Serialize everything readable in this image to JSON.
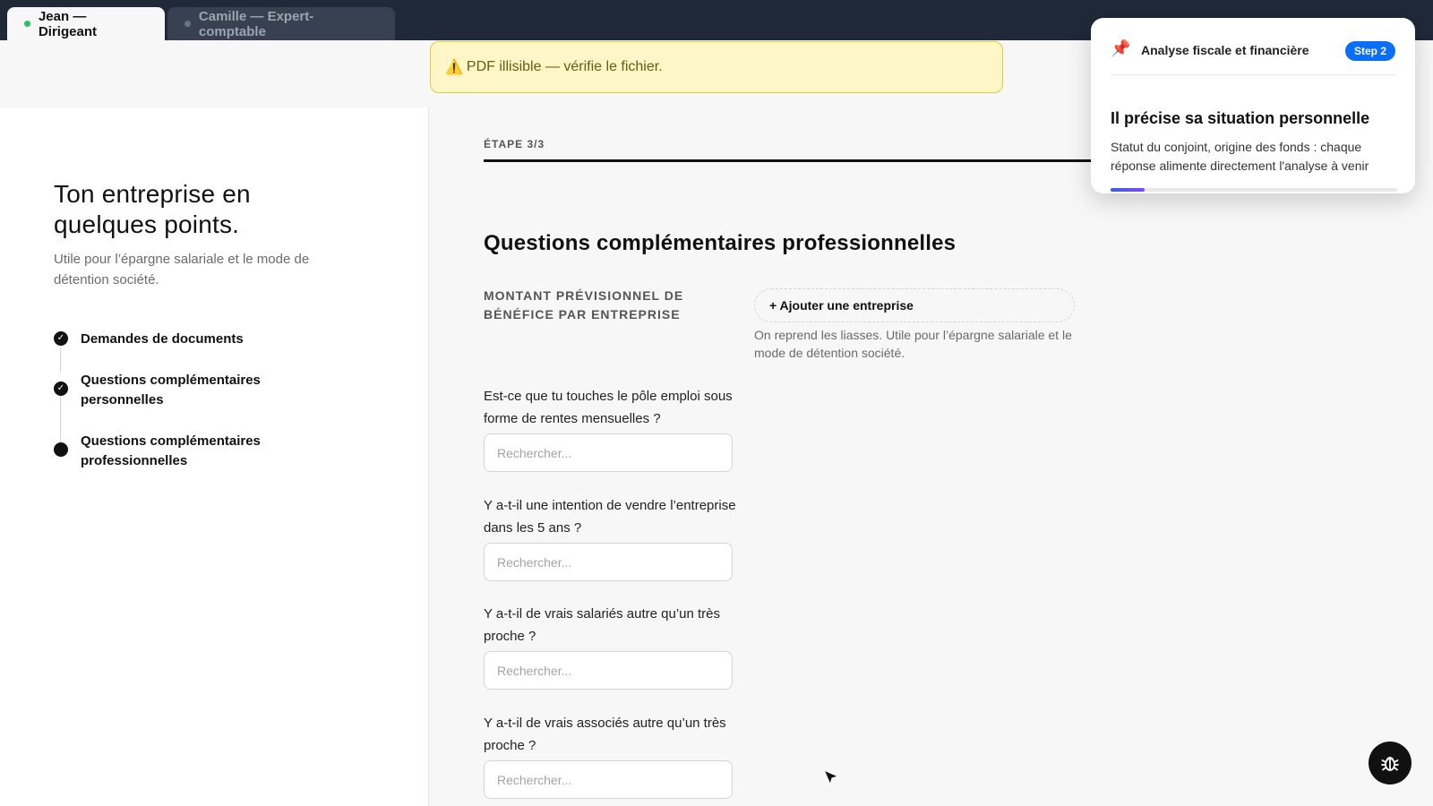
{
  "tabs": [
    {
      "label": "Jean — Dirigeant",
      "status_color": "#22c55e"
    },
    {
      "label": "Camille — Expert-comptable",
      "status_color": "#6b7280"
    }
  ],
  "alert": {
    "icon": "warning-icon",
    "text": "PDF illisible — vérifie le fichier."
  },
  "sidebar": {
    "title": "Ton entreprise en quelques points.",
    "subtitle": "Utile pour l’épargne salariale et le mode de détention société.",
    "steps": [
      {
        "label": "Demandes de documents",
        "state": "done"
      },
      {
        "label": "Questions complémentaires personnelles",
        "state": "done"
      },
      {
        "label": "Questions complémentaires professionnelles",
        "state": "current"
      }
    ]
  },
  "main": {
    "step_indicator": "ÉTAPE 3/3",
    "section_title": "Questions complémentaires professionnelles",
    "montant": {
      "label": "MONTANT PRÉVISIONNEL DE BÉNÉFICE PAR ENTREPRISE",
      "add_button": "+ Ajouter une entreprise",
      "hint": "On reprend les liasses. Utile pour l’épargne salariale et le mode de détention société."
    },
    "questions": [
      {
        "text": "Est-ce que tu touches le pôle emploi sous forme de rentes mensuelles ?",
        "placeholder": "Rechercher...",
        "value": ""
      },
      {
        "text": "Y a-t-il une intention de vendre l’entreprise dans les 5 ans ?",
        "placeholder": "Rechercher...",
        "value": ""
      },
      {
        "text": "Y a-t-il de vrais salariés autre qu’un très proche ?",
        "placeholder": "Rechercher...",
        "value": ""
      },
      {
        "text": "Y a-t-il de vrais associés autre qu’un très proche ?",
        "placeholder": "Rechercher...",
        "value": ""
      }
    ]
  },
  "popover": {
    "icon": "pushpin-icon",
    "kicker": "Analyse fiscale et financière",
    "badge": "Step 2",
    "title": "Il précise sa situation personnelle",
    "description": "Statut du conjoint, origine des fonds : chaque réponse alimente directement l'analyse à venir",
    "progress": 0.12
  },
  "floating_button": {
    "icon": "bug-icon"
  },
  "colors": {
    "accent_blue": "#0b6ef9",
    "alert_bg": "#fdf6c6",
    "alert_border": "#e5c93d",
    "topbar": "#1f2937"
  }
}
